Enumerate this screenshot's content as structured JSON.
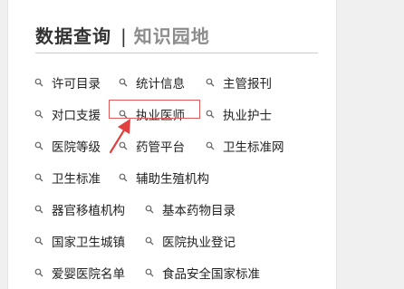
{
  "tabs": {
    "active": "数据查询",
    "separator": "|",
    "inactive": "知识园地"
  },
  "links": [
    "许可目录",
    "统计信息",
    "主管报刊",
    "对口支援",
    "执业医师",
    "执业护士",
    "医院等级",
    "药管平台",
    "卫生标准网",
    "卫生标准",
    "辅助生殖机构",
    "器官移植机构",
    "基本药物目录",
    "国家卫生城镇",
    "医院执业登记",
    "爱婴医院名单",
    "食品安全国家标准"
  ],
  "highlighted_link": "执业医师",
  "icons": {
    "link_icon": "search-icon",
    "annotation": "red-arrow-icon"
  },
  "colors": {
    "highlight": "#e05a5a",
    "text": "#222222",
    "inactive_tab": "#8c8c8c"
  }
}
